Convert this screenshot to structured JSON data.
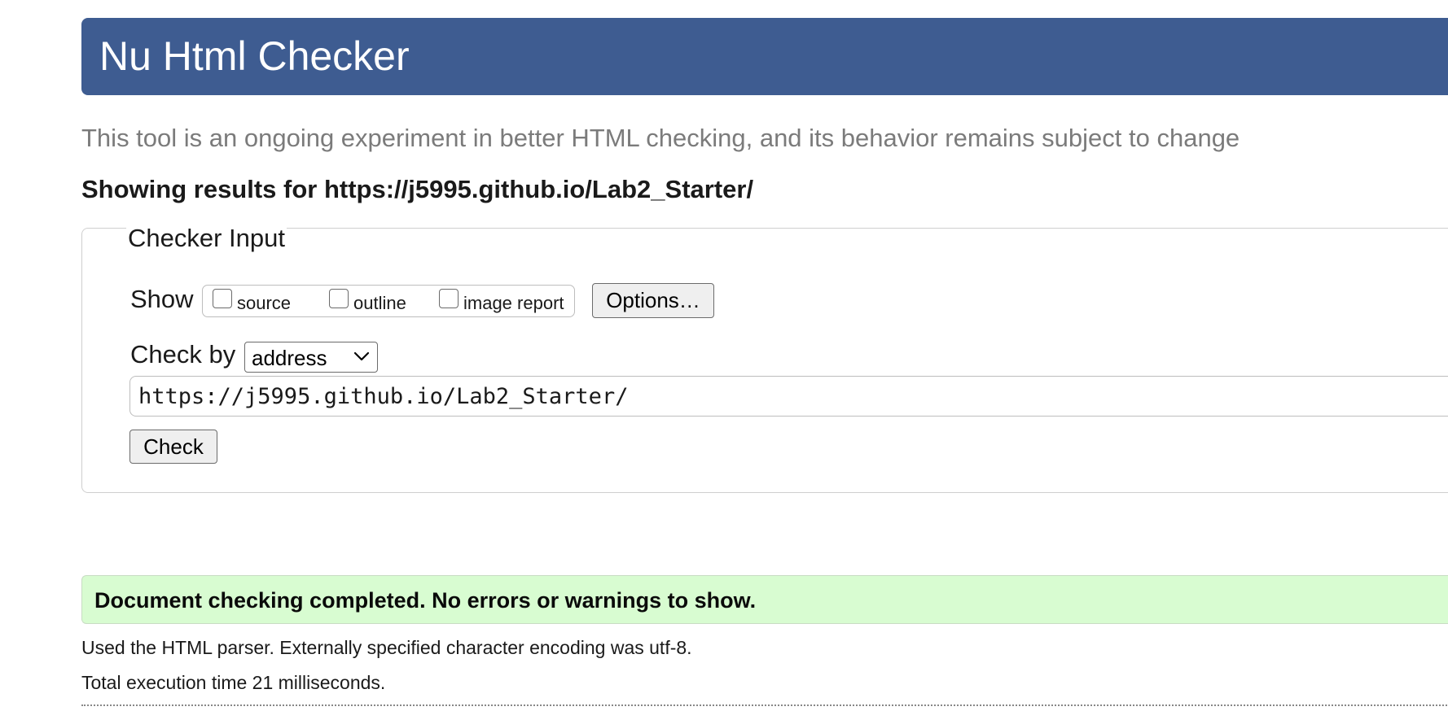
{
  "header": {
    "title": "Nu Html Checker",
    "banner_color": "#3e5c91"
  },
  "subtitle": "This tool is an ongoing experiment in better HTML checking, and its behavior remains subject to change",
  "showing": {
    "prefix": "Showing results for ",
    "url": "https://j5995.github.io/Lab2_Starter/"
  },
  "checker_input": {
    "legend": "Checker Input",
    "show_label": "Show",
    "show_options": [
      {
        "label": "source",
        "checked": false
      },
      {
        "label": "outline",
        "checked": false
      },
      {
        "label": "image report",
        "checked": false
      }
    ],
    "options_button": "Options…",
    "check_by_label": "Check by",
    "check_by_selected": "address",
    "url_value": "https://j5995.github.io/Lab2_Starter/",
    "check_button": "Check"
  },
  "result": {
    "message": "Document checking completed. No errors or warnings to show.",
    "color": "#d8fcd1",
    "parser_info": "Used the HTML parser. Externally specified character encoding was utf-8.",
    "execution_time": "Total execution time 21 milliseconds."
  }
}
